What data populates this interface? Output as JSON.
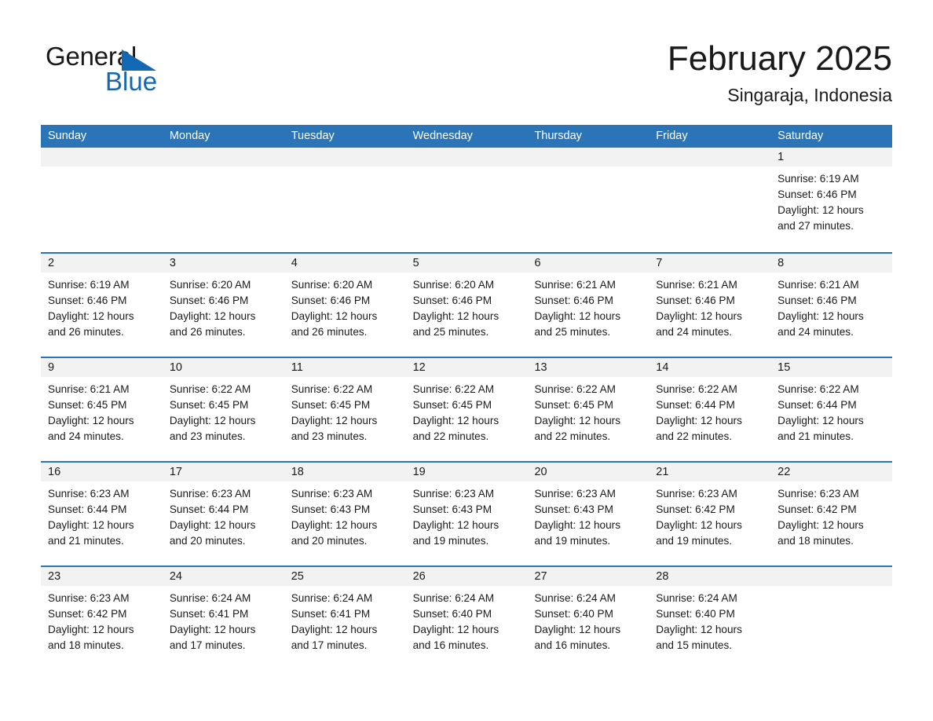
{
  "brand": {
    "name_top": "General",
    "name_bottom": "Blue",
    "accent_color": "#1268b3"
  },
  "header": {
    "title": "February 2025",
    "subtitle": "Singaraja, Indonesia"
  },
  "theme": {
    "header_blue": "#2b74b8",
    "day_band_gray": "#f2f2f2",
    "text_color": "#1a1a1a"
  },
  "weekdays": [
    "Sunday",
    "Monday",
    "Tuesday",
    "Wednesday",
    "Thursday",
    "Friday",
    "Saturday"
  ],
  "weeks": [
    [
      {
        "day": "",
        "sunrise": "",
        "sunset": "",
        "daylight_1": "",
        "daylight_2": ""
      },
      {
        "day": "",
        "sunrise": "",
        "sunset": "",
        "daylight_1": "",
        "daylight_2": ""
      },
      {
        "day": "",
        "sunrise": "",
        "sunset": "",
        "daylight_1": "",
        "daylight_2": ""
      },
      {
        "day": "",
        "sunrise": "",
        "sunset": "",
        "daylight_1": "",
        "daylight_2": ""
      },
      {
        "day": "",
        "sunrise": "",
        "sunset": "",
        "daylight_1": "",
        "daylight_2": ""
      },
      {
        "day": "",
        "sunrise": "",
        "sunset": "",
        "daylight_1": "",
        "daylight_2": ""
      },
      {
        "day": "1",
        "sunrise": "Sunrise: 6:19 AM",
        "sunset": "Sunset: 6:46 PM",
        "daylight_1": "Daylight: 12 hours",
        "daylight_2": "and 27 minutes."
      }
    ],
    [
      {
        "day": "2",
        "sunrise": "Sunrise: 6:19 AM",
        "sunset": "Sunset: 6:46 PM",
        "daylight_1": "Daylight: 12 hours",
        "daylight_2": "and 26 minutes."
      },
      {
        "day": "3",
        "sunrise": "Sunrise: 6:20 AM",
        "sunset": "Sunset: 6:46 PM",
        "daylight_1": "Daylight: 12 hours",
        "daylight_2": "and 26 minutes."
      },
      {
        "day": "4",
        "sunrise": "Sunrise: 6:20 AM",
        "sunset": "Sunset: 6:46 PM",
        "daylight_1": "Daylight: 12 hours",
        "daylight_2": "and 26 minutes."
      },
      {
        "day": "5",
        "sunrise": "Sunrise: 6:20 AM",
        "sunset": "Sunset: 6:46 PM",
        "daylight_1": "Daylight: 12 hours",
        "daylight_2": "and 25 minutes."
      },
      {
        "day": "6",
        "sunrise": "Sunrise: 6:21 AM",
        "sunset": "Sunset: 6:46 PM",
        "daylight_1": "Daylight: 12 hours",
        "daylight_2": "and 25 minutes."
      },
      {
        "day": "7",
        "sunrise": "Sunrise: 6:21 AM",
        "sunset": "Sunset: 6:46 PM",
        "daylight_1": "Daylight: 12 hours",
        "daylight_2": "and 24 minutes."
      },
      {
        "day": "8",
        "sunrise": "Sunrise: 6:21 AM",
        "sunset": "Sunset: 6:46 PM",
        "daylight_1": "Daylight: 12 hours",
        "daylight_2": "and 24 minutes."
      }
    ],
    [
      {
        "day": "9",
        "sunrise": "Sunrise: 6:21 AM",
        "sunset": "Sunset: 6:45 PM",
        "daylight_1": "Daylight: 12 hours",
        "daylight_2": "and 24 minutes."
      },
      {
        "day": "10",
        "sunrise": "Sunrise: 6:22 AM",
        "sunset": "Sunset: 6:45 PM",
        "daylight_1": "Daylight: 12 hours",
        "daylight_2": "and 23 minutes."
      },
      {
        "day": "11",
        "sunrise": "Sunrise: 6:22 AM",
        "sunset": "Sunset: 6:45 PM",
        "daylight_1": "Daylight: 12 hours",
        "daylight_2": "and 23 minutes."
      },
      {
        "day": "12",
        "sunrise": "Sunrise: 6:22 AM",
        "sunset": "Sunset: 6:45 PM",
        "daylight_1": "Daylight: 12 hours",
        "daylight_2": "and 22 minutes."
      },
      {
        "day": "13",
        "sunrise": "Sunrise: 6:22 AM",
        "sunset": "Sunset: 6:45 PM",
        "daylight_1": "Daylight: 12 hours",
        "daylight_2": "and 22 minutes."
      },
      {
        "day": "14",
        "sunrise": "Sunrise: 6:22 AM",
        "sunset": "Sunset: 6:44 PM",
        "daylight_1": "Daylight: 12 hours",
        "daylight_2": "and 22 minutes."
      },
      {
        "day": "15",
        "sunrise": "Sunrise: 6:22 AM",
        "sunset": "Sunset: 6:44 PM",
        "daylight_1": "Daylight: 12 hours",
        "daylight_2": "and 21 minutes."
      }
    ],
    [
      {
        "day": "16",
        "sunrise": "Sunrise: 6:23 AM",
        "sunset": "Sunset: 6:44 PM",
        "daylight_1": "Daylight: 12 hours",
        "daylight_2": "and 21 minutes."
      },
      {
        "day": "17",
        "sunrise": "Sunrise: 6:23 AM",
        "sunset": "Sunset: 6:44 PM",
        "daylight_1": "Daylight: 12 hours",
        "daylight_2": "and 20 minutes."
      },
      {
        "day": "18",
        "sunrise": "Sunrise: 6:23 AM",
        "sunset": "Sunset: 6:43 PM",
        "daylight_1": "Daylight: 12 hours",
        "daylight_2": "and 20 minutes."
      },
      {
        "day": "19",
        "sunrise": "Sunrise: 6:23 AM",
        "sunset": "Sunset: 6:43 PM",
        "daylight_1": "Daylight: 12 hours",
        "daylight_2": "and 19 minutes."
      },
      {
        "day": "20",
        "sunrise": "Sunrise: 6:23 AM",
        "sunset": "Sunset: 6:43 PM",
        "daylight_1": "Daylight: 12 hours",
        "daylight_2": "and 19 minutes."
      },
      {
        "day": "21",
        "sunrise": "Sunrise: 6:23 AM",
        "sunset": "Sunset: 6:42 PM",
        "daylight_1": "Daylight: 12 hours",
        "daylight_2": "and 19 minutes."
      },
      {
        "day": "22",
        "sunrise": "Sunrise: 6:23 AM",
        "sunset": "Sunset: 6:42 PM",
        "daylight_1": "Daylight: 12 hours",
        "daylight_2": "and 18 minutes."
      }
    ],
    [
      {
        "day": "23",
        "sunrise": "Sunrise: 6:23 AM",
        "sunset": "Sunset: 6:42 PM",
        "daylight_1": "Daylight: 12 hours",
        "daylight_2": "and 18 minutes."
      },
      {
        "day": "24",
        "sunrise": "Sunrise: 6:24 AM",
        "sunset": "Sunset: 6:41 PM",
        "daylight_1": "Daylight: 12 hours",
        "daylight_2": "and 17 minutes."
      },
      {
        "day": "25",
        "sunrise": "Sunrise: 6:24 AM",
        "sunset": "Sunset: 6:41 PM",
        "daylight_1": "Daylight: 12 hours",
        "daylight_2": "and 17 minutes."
      },
      {
        "day": "26",
        "sunrise": "Sunrise: 6:24 AM",
        "sunset": "Sunset: 6:40 PM",
        "daylight_1": "Daylight: 12 hours",
        "daylight_2": "and 16 minutes."
      },
      {
        "day": "27",
        "sunrise": "Sunrise: 6:24 AM",
        "sunset": "Sunset: 6:40 PM",
        "daylight_1": "Daylight: 12 hours",
        "daylight_2": "and 16 minutes."
      },
      {
        "day": "28",
        "sunrise": "Sunrise: 6:24 AM",
        "sunset": "Sunset: 6:40 PM",
        "daylight_1": "Daylight: 12 hours",
        "daylight_2": "and 15 minutes."
      },
      {
        "day": "",
        "sunrise": "",
        "sunset": "",
        "daylight_1": "",
        "daylight_2": ""
      }
    ]
  ]
}
